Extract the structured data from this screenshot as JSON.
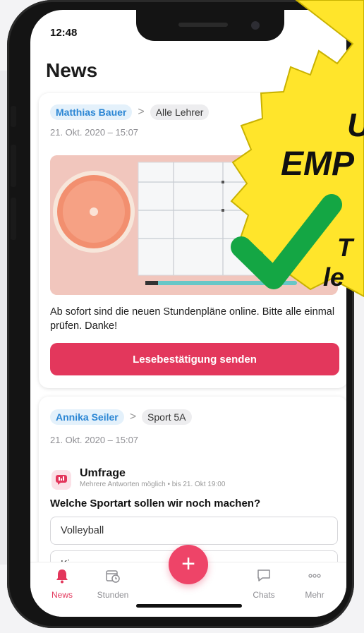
{
  "status_bar": {
    "time": "12:48"
  },
  "header": {
    "title": "News"
  },
  "posts": [
    {
      "author": "Matthias Bauer",
      "separator": ">",
      "group": "Alle Lehrer",
      "date": "21. Okt. 2020 – 15:07",
      "text": "Ab sofort sind die neuen Stundenpläne online. Bitte alle einmal prüfen. Danke!",
      "button_label": "Lesebestätigung senden"
    },
    {
      "author": "Annika Seiler",
      "separator": ">",
      "group": "Sport 5A",
      "date": "21. Okt. 2020 – 15:07",
      "poll": {
        "title": "Umfrage",
        "subtitle": "Mehrere Antworten möglich • bis 21. Okt 19:00",
        "question": "Welche Sportart sollen wir noch machen?",
        "options": [
          "Volleyball",
          "Kino"
        ]
      }
    }
  ],
  "tabs": [
    {
      "label": "News",
      "icon": "bell-icon",
      "active": true
    },
    {
      "label": "Stunden",
      "icon": "calendar-clock-icon",
      "active": false
    },
    {
      "label": "Chats",
      "icon": "chat-bubble-icon",
      "active": false
    },
    {
      "label": "Mehr",
      "icon": "more-dots-icon",
      "active": false
    }
  ],
  "fab_label": "+",
  "badge": {
    "line1": "U",
    "line2": "EMP",
    "line3": "T",
    "line4": "le",
    "colors": {
      "star": "#ffe52b",
      "check": "#14a644"
    }
  },
  "colors": {
    "accent": "#e3375c",
    "author_chip": "#2b86d4"
  }
}
